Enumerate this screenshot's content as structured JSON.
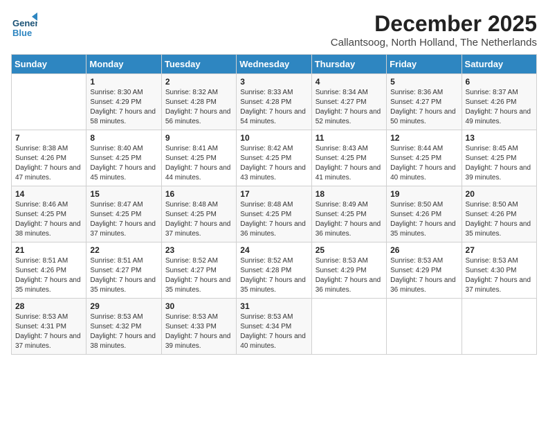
{
  "logo": {
    "general": "General",
    "blue": "Blue"
  },
  "title": "December 2025",
  "location": "Callantsoog, North Holland, The Netherlands",
  "headers": [
    "Sunday",
    "Monday",
    "Tuesday",
    "Wednesday",
    "Thursday",
    "Friday",
    "Saturday"
  ],
  "weeks": [
    [
      {
        "day": "",
        "sunrise": "",
        "sunset": "",
        "daylight": ""
      },
      {
        "day": "1",
        "sunrise": "Sunrise: 8:30 AM",
        "sunset": "Sunset: 4:29 PM",
        "daylight": "Daylight: 7 hours and 58 minutes."
      },
      {
        "day": "2",
        "sunrise": "Sunrise: 8:32 AM",
        "sunset": "Sunset: 4:28 PM",
        "daylight": "Daylight: 7 hours and 56 minutes."
      },
      {
        "day": "3",
        "sunrise": "Sunrise: 8:33 AM",
        "sunset": "Sunset: 4:28 PM",
        "daylight": "Daylight: 7 hours and 54 minutes."
      },
      {
        "day": "4",
        "sunrise": "Sunrise: 8:34 AM",
        "sunset": "Sunset: 4:27 PM",
        "daylight": "Daylight: 7 hours and 52 minutes."
      },
      {
        "day": "5",
        "sunrise": "Sunrise: 8:36 AM",
        "sunset": "Sunset: 4:27 PM",
        "daylight": "Daylight: 7 hours and 50 minutes."
      },
      {
        "day": "6",
        "sunrise": "Sunrise: 8:37 AM",
        "sunset": "Sunset: 4:26 PM",
        "daylight": "Daylight: 7 hours and 49 minutes."
      }
    ],
    [
      {
        "day": "7",
        "sunrise": "Sunrise: 8:38 AM",
        "sunset": "Sunset: 4:26 PM",
        "daylight": "Daylight: 7 hours and 47 minutes."
      },
      {
        "day": "8",
        "sunrise": "Sunrise: 8:40 AM",
        "sunset": "Sunset: 4:25 PM",
        "daylight": "Daylight: 7 hours and 45 minutes."
      },
      {
        "day": "9",
        "sunrise": "Sunrise: 8:41 AM",
        "sunset": "Sunset: 4:25 PM",
        "daylight": "Daylight: 7 hours and 44 minutes."
      },
      {
        "day": "10",
        "sunrise": "Sunrise: 8:42 AM",
        "sunset": "Sunset: 4:25 PM",
        "daylight": "Daylight: 7 hours and 43 minutes."
      },
      {
        "day": "11",
        "sunrise": "Sunrise: 8:43 AM",
        "sunset": "Sunset: 4:25 PM",
        "daylight": "Daylight: 7 hours and 41 minutes."
      },
      {
        "day": "12",
        "sunrise": "Sunrise: 8:44 AM",
        "sunset": "Sunset: 4:25 PM",
        "daylight": "Daylight: 7 hours and 40 minutes."
      },
      {
        "day": "13",
        "sunrise": "Sunrise: 8:45 AM",
        "sunset": "Sunset: 4:25 PM",
        "daylight": "Daylight: 7 hours and 39 minutes."
      }
    ],
    [
      {
        "day": "14",
        "sunrise": "Sunrise: 8:46 AM",
        "sunset": "Sunset: 4:25 PM",
        "daylight": "Daylight: 7 hours and 38 minutes."
      },
      {
        "day": "15",
        "sunrise": "Sunrise: 8:47 AM",
        "sunset": "Sunset: 4:25 PM",
        "daylight": "Daylight: 7 hours and 37 minutes."
      },
      {
        "day": "16",
        "sunrise": "Sunrise: 8:48 AM",
        "sunset": "Sunset: 4:25 PM",
        "daylight": "Daylight: 7 hours and 37 minutes."
      },
      {
        "day": "17",
        "sunrise": "Sunrise: 8:48 AM",
        "sunset": "Sunset: 4:25 PM",
        "daylight": "Daylight: 7 hours and 36 minutes."
      },
      {
        "day": "18",
        "sunrise": "Sunrise: 8:49 AM",
        "sunset": "Sunset: 4:25 PM",
        "daylight": "Daylight: 7 hours and 36 minutes."
      },
      {
        "day": "19",
        "sunrise": "Sunrise: 8:50 AM",
        "sunset": "Sunset: 4:26 PM",
        "daylight": "Daylight: 7 hours and 35 minutes."
      },
      {
        "day": "20",
        "sunrise": "Sunrise: 8:50 AM",
        "sunset": "Sunset: 4:26 PM",
        "daylight": "Daylight: 7 hours and 35 minutes."
      }
    ],
    [
      {
        "day": "21",
        "sunrise": "Sunrise: 8:51 AM",
        "sunset": "Sunset: 4:26 PM",
        "daylight": "Daylight: 7 hours and 35 minutes."
      },
      {
        "day": "22",
        "sunrise": "Sunrise: 8:51 AM",
        "sunset": "Sunset: 4:27 PM",
        "daylight": "Daylight: 7 hours and 35 minutes."
      },
      {
        "day": "23",
        "sunrise": "Sunrise: 8:52 AM",
        "sunset": "Sunset: 4:27 PM",
        "daylight": "Daylight: 7 hours and 35 minutes."
      },
      {
        "day": "24",
        "sunrise": "Sunrise: 8:52 AM",
        "sunset": "Sunset: 4:28 PM",
        "daylight": "Daylight: 7 hours and 35 minutes."
      },
      {
        "day": "25",
        "sunrise": "Sunrise: 8:53 AM",
        "sunset": "Sunset: 4:29 PM",
        "daylight": "Daylight: 7 hours and 36 minutes."
      },
      {
        "day": "26",
        "sunrise": "Sunrise: 8:53 AM",
        "sunset": "Sunset: 4:29 PM",
        "daylight": "Daylight: 7 hours and 36 minutes."
      },
      {
        "day": "27",
        "sunrise": "Sunrise: 8:53 AM",
        "sunset": "Sunset: 4:30 PM",
        "daylight": "Daylight: 7 hours and 37 minutes."
      }
    ],
    [
      {
        "day": "28",
        "sunrise": "Sunrise: 8:53 AM",
        "sunset": "Sunset: 4:31 PM",
        "daylight": "Daylight: 7 hours and 37 minutes."
      },
      {
        "day": "29",
        "sunrise": "Sunrise: 8:53 AM",
        "sunset": "Sunset: 4:32 PM",
        "daylight": "Daylight: 7 hours and 38 minutes."
      },
      {
        "day": "30",
        "sunrise": "Sunrise: 8:53 AM",
        "sunset": "Sunset: 4:33 PM",
        "daylight": "Daylight: 7 hours and 39 minutes."
      },
      {
        "day": "31",
        "sunrise": "Sunrise: 8:53 AM",
        "sunset": "Sunset: 4:34 PM",
        "daylight": "Daylight: 7 hours and 40 minutes."
      },
      {
        "day": "",
        "sunrise": "",
        "sunset": "",
        "daylight": ""
      },
      {
        "day": "",
        "sunrise": "",
        "sunset": "",
        "daylight": ""
      },
      {
        "day": "",
        "sunrise": "",
        "sunset": "",
        "daylight": ""
      }
    ]
  ]
}
